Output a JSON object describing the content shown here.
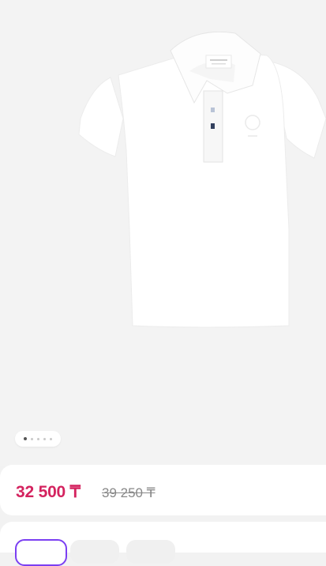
{
  "product": {
    "image_alt": "White polo shirt",
    "price": "32 500 ₸",
    "old_price": "39 250 ₸"
  },
  "gallery": {
    "slide_count": 5,
    "active_slide": 1
  },
  "colors": {
    "price": "#d4235f",
    "selected_outline": "#7b3ff2"
  }
}
